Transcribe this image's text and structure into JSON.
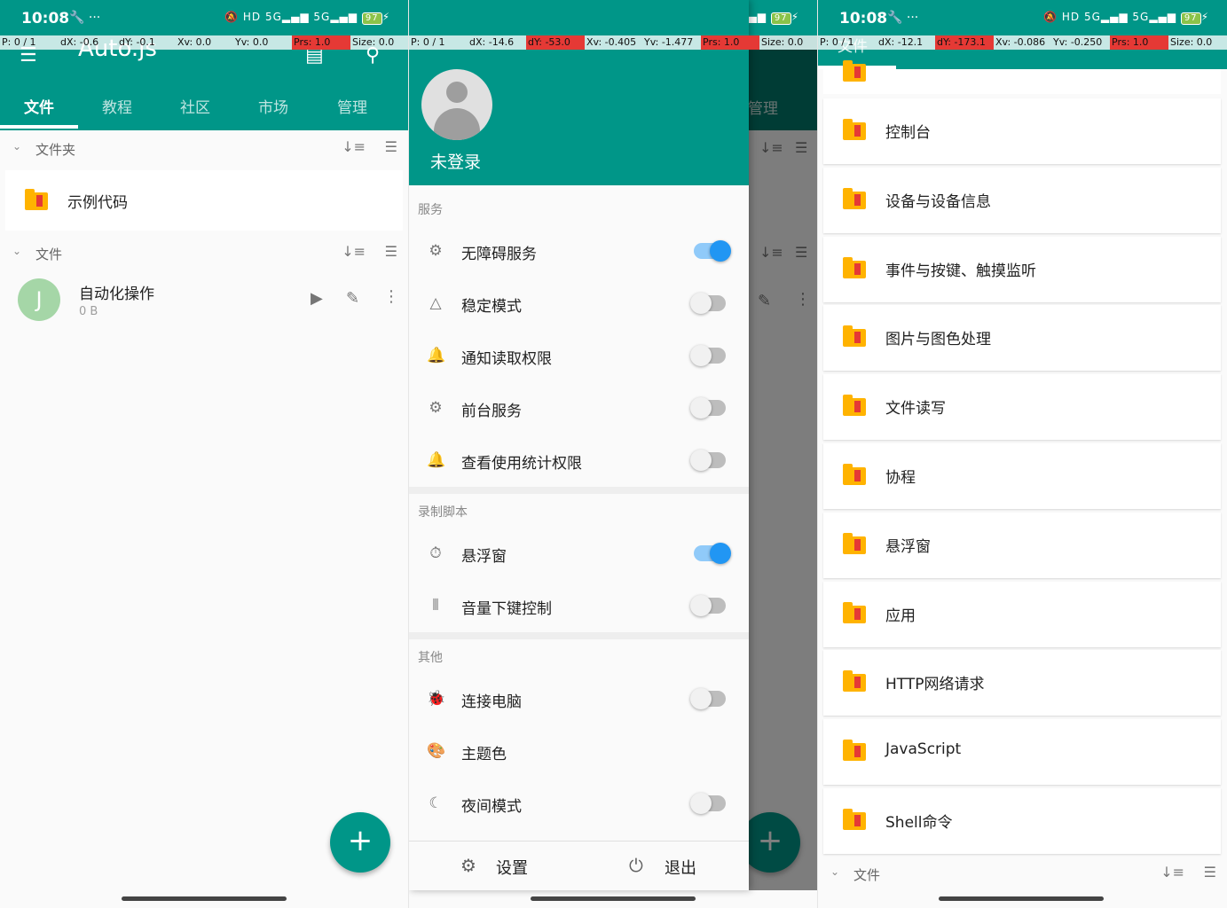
{
  "status": {
    "time": "10:08",
    "battery": "97",
    "signal": "5G",
    "hd": "HD"
  },
  "pointer_bar": [
    {
      "text": "P: 0 / 1",
      "red": false
    },
    {
      "text": "dX: -0.6",
      "red": false
    },
    {
      "text": "dY: -0.1",
      "red": false
    },
    {
      "text": "Xv: 0.0",
      "red": false
    },
    {
      "text": "Yv: 0.0",
      "red": false
    },
    {
      "text": "Prs: 1.0",
      "red": true
    },
    {
      "text": "Size: 0.0",
      "red": false
    }
  ],
  "pointer_bar2": [
    {
      "text": "P: 0 / 1",
      "red": false
    },
    {
      "text": "dX: -14.6",
      "red": false
    },
    {
      "text": "dY: -53.0",
      "red": true
    },
    {
      "text": "Xv: -0.405",
      "red": false
    },
    {
      "text": "Yv: -1.477",
      "red": false
    },
    {
      "text": "Prs: 1.0",
      "red": true
    },
    {
      "text": "Size: 0.0",
      "red": false
    }
  ],
  "pointer_bar3": [
    {
      "text": "P: 0 / 1",
      "red": false
    },
    {
      "text": "dX: -12.1",
      "red": false
    },
    {
      "text": "dY: -173.1",
      "red": true
    },
    {
      "text": "Xv: -0.086",
      "red": false
    },
    {
      "text": "Yv: -0.250",
      "red": false
    },
    {
      "text": "Prs: 1.0",
      "red": true
    },
    {
      "text": "Size: 0.0",
      "red": false
    }
  ],
  "app": {
    "title": "Auto.js"
  },
  "tabs": [
    "文件",
    "教程",
    "社区",
    "市场",
    "管理"
  ],
  "folders_section": {
    "label": "文件夹",
    "items": [
      "示例代码"
    ]
  },
  "files_section": {
    "label": "文件",
    "items": [
      {
        "avatar": "J",
        "name": "自动化操作",
        "size": "0 B"
      }
    ]
  },
  "drawer": {
    "login": "未登录",
    "services_label": "服务",
    "services": [
      {
        "label": "无障碍服务",
        "on": true
      },
      {
        "label": "稳定模式",
        "on": false
      },
      {
        "label": "通知读取权限",
        "on": false
      },
      {
        "label": "前台服务",
        "on": false
      },
      {
        "label": "查看使用统计权限",
        "on": false
      }
    ],
    "record_label": "录制脚本",
    "record": [
      {
        "label": "悬浮窗",
        "on": true
      },
      {
        "label": "音量下键控制",
        "on": false
      }
    ],
    "other_label": "其他",
    "other": [
      {
        "label": "连接电脑",
        "on": false
      },
      {
        "label": "主题色"
      },
      {
        "label": "夜间模式",
        "on": false
      }
    ],
    "settings": "设置",
    "exit": "退出"
  },
  "behind_tab": "管理",
  "examples": [
    "控制台",
    "设备与设备信息",
    "事件与按键、触摸监听",
    "图片与图色处理",
    "文件读写",
    "协程",
    "悬浮窗",
    "应用",
    "HTTP网络请求",
    "JavaScript",
    "Shell命令"
  ],
  "p3_tab": "文件",
  "p3_files_label": "文件"
}
